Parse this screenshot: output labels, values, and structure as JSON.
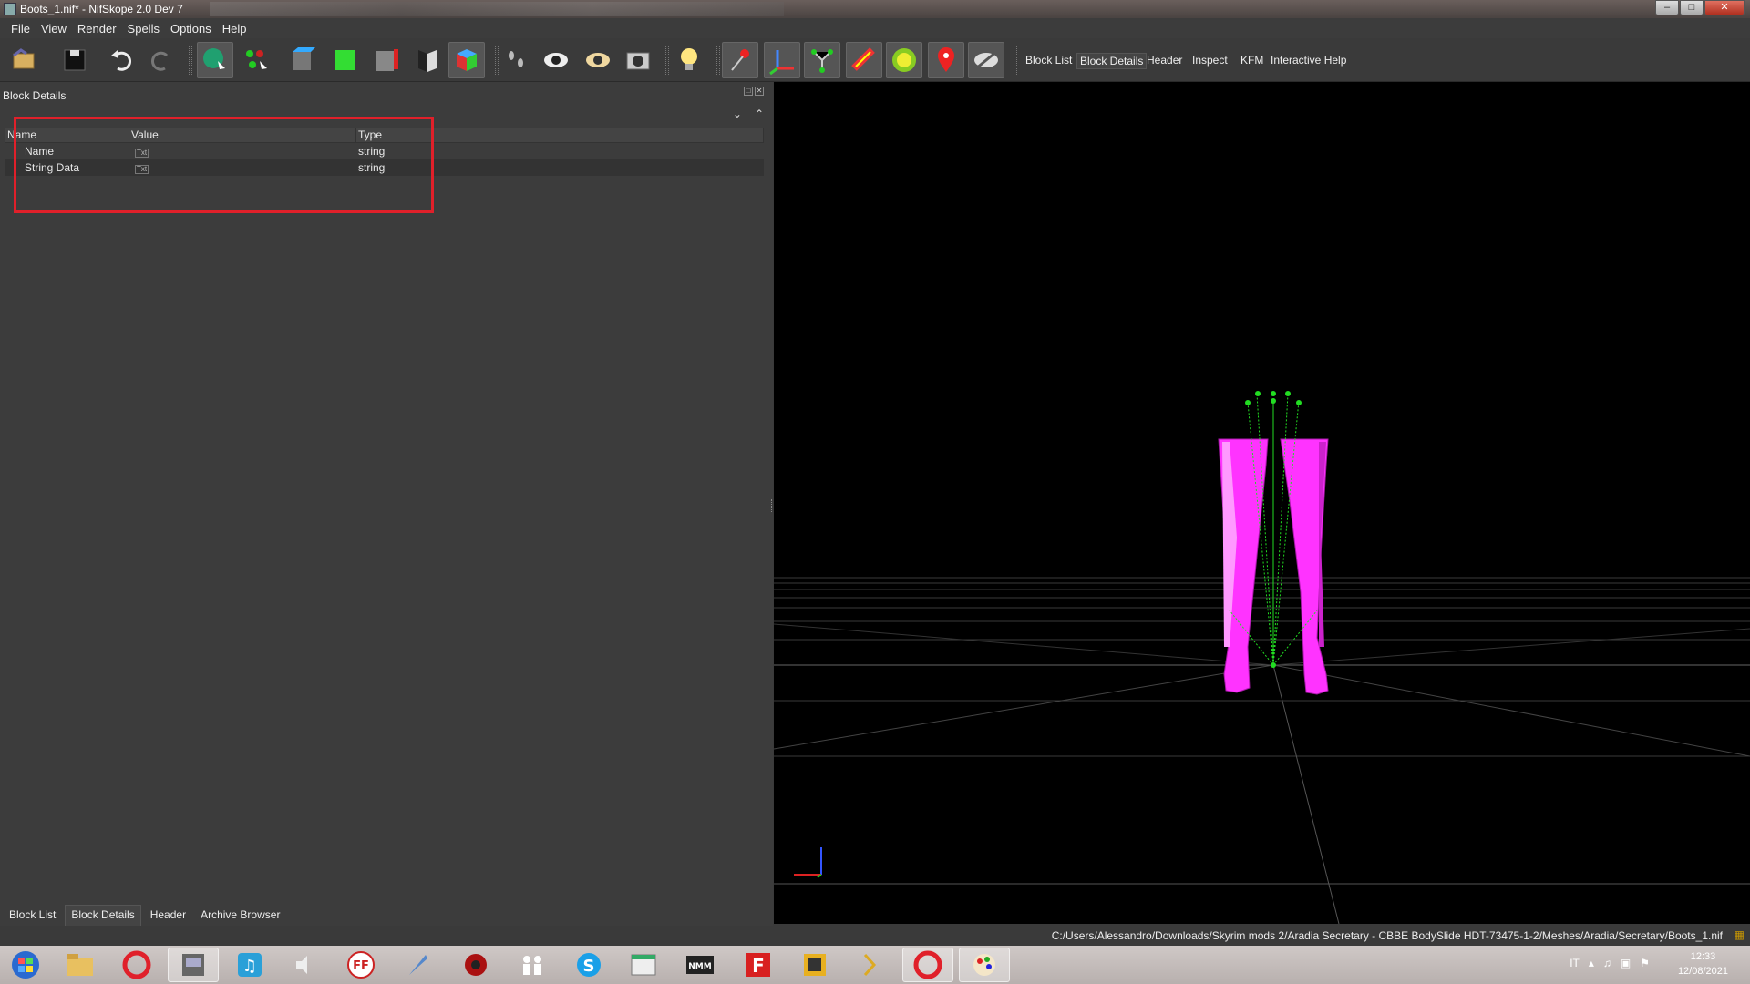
{
  "window": {
    "title": "Boots_1.nif* - NifSkope 2.0 Dev 7",
    "controls": [
      "–",
      "□",
      "✕"
    ]
  },
  "menu": [
    "File",
    "View",
    "Render",
    "Spells",
    "Options",
    "Help"
  ],
  "toolbar": {
    "icons": [
      "load-icon",
      "save-icon",
      "undo-icon",
      "redo-icon",
      "select-object-icon",
      "select-vertex-icon",
      "blue-cube-icon",
      "green-cube-icon",
      "red-cube-icon",
      "flip-cube-icon",
      "color-cube-icon",
      "footprints-icon",
      "eye-icon",
      "eye-outline-icon",
      "camera-icon",
      "lightbulb-icon",
      "pin-icon",
      "axes-icon",
      "nodes-icon",
      "constraints-icon",
      "havok-icon",
      "marker-icon",
      "hidden-eye-icon"
    ],
    "dock_links": [
      "Block List",
      "Block Details",
      "Header",
      "Inspect",
      "KFM",
      "Interactive Help"
    ],
    "active_link": "Block Details"
  },
  "panel": {
    "title": "Block Details",
    "table": {
      "headers": [
        "Name",
        "Value",
        "Type"
      ],
      "rows": [
        {
          "name": "Name",
          "value_icon": "Txt",
          "type": "string"
        },
        {
          "name": "String Data",
          "value_icon": "Txt",
          "type": "string"
        }
      ]
    },
    "bottom_tabs": [
      "Block List",
      "Block Details",
      "Header",
      "Archive Browser"
    ],
    "active_tab": "Block Details"
  },
  "status": {
    "path": "C:/Users/Alessandro/Downloads/Skyrim mods 2/Aradia Secretary - CBBE BodySlide HDT-73475-1-2/Meshes/Aradia/Secretary/Boots_1.nif"
  },
  "taskbar": {
    "apps": [
      "windows-start-icon",
      "file-explorer-icon",
      "opera-icon",
      "app-icon",
      "music-icon",
      "speaker-icon",
      "ffdec-icon",
      "quill-icon",
      "spider-icon",
      "people-icon",
      "skype-icon",
      "window-icon",
      "nmm-icon",
      "f-icon",
      "archive-icon",
      "arrow-icon",
      "opera-active-icon",
      "paint-icon"
    ],
    "tray_lang": "IT",
    "time": "12:33",
    "date": "12/08/2021"
  },
  "colors": {
    "boots": "#ff33ff",
    "bones": "#22dd22",
    "highlight": "#e0202a"
  }
}
